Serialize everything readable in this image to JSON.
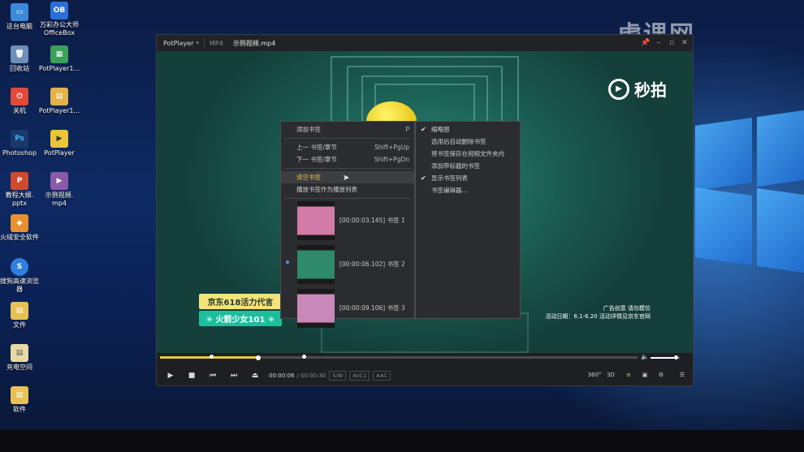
{
  "desktop": {
    "icons": [
      {
        "label": "这台电脑",
        "glyph": "▭",
        "color": "#3b8ad9"
      },
      {
        "label": "万彩办公大师\nOfficeBox",
        "glyph": "OB",
        "color": "#2a6fd8"
      },
      {
        "label": "回收站",
        "glyph": "🗑",
        "color": "#6f8fb8"
      },
      {
        "label": "PotPlayer1...",
        "glyph": "▦",
        "color": "#3aa05a"
      },
      {
        "label": "关机",
        "glyph": "⏻",
        "color": "#e04a3a"
      },
      {
        "label": "PotPlayer1...",
        "glyph": "▤",
        "color": "#e2b34a"
      },
      {
        "label": "Photoshop",
        "glyph": "Ps",
        "color": "#1b3a6a"
      },
      {
        "label": "PotPlayer",
        "glyph": "▶",
        "color": "#e9c53a"
      },
      {
        "label": "教程大纲.\npptx",
        "glyph": "P",
        "color": "#d04a2e"
      },
      {
        "label": "示例视频.\nmp4",
        "glyph": "▶",
        "color": "#8a5aa8"
      },
      {
        "label": "火绒安全软件",
        "glyph": "◆",
        "color": "#e8912e"
      },
      {
        "label": "搜狗高速浏览\n器",
        "glyph": "S",
        "color": "#2f7fe0"
      },
      {
        "label": "文件",
        "glyph": "▤",
        "color": "#e7c253"
      },
      {
        "label": "充电空间",
        "glyph": "▤",
        "color": "#e7d9a6"
      },
      {
        "label": "软件",
        "glyph": "▤",
        "color": "#e7c253"
      }
    ],
    "watermark": "虎课网"
  },
  "player": {
    "brand": "PotPlayer",
    "format": "MP4",
    "filename": "示例视频.mp4",
    "window_buttons": [
      "📌",
      "–",
      "▫",
      "✕"
    ],
    "video": {
      "logo_text": "秒拍",
      "badge_top": "京东618活力代言",
      "badge_bottom": "✳ 火箭少女101 ✳",
      "ad_line1": "广告创意 请勿模仿",
      "ad_line2": "活动日期：6.1-6.20 活动详情见京东官网"
    },
    "menu_left": {
      "add": {
        "label": "添加书签",
        "shortcut": "P"
      },
      "prev": {
        "label": "上一 书签/章节",
        "shortcut": "Shift+PgUp"
      },
      "next": {
        "label": "下一 书签/章节",
        "shortcut": "Shift+PgDn"
      },
      "clear": {
        "label": "清空书签"
      },
      "playlist": {
        "label": "播放书签作为播放列表"
      },
      "bookmarks": [
        {
          "label": "[00:00:03.145] 书签 1",
          "thumb": "#d27aa8"
        },
        {
          "label": "[00:00:06.102] 书签 2",
          "thumb": "#2e8a6a"
        },
        {
          "label": "[00:00:09.106] 书签 3",
          "thumb": "#c889b8"
        }
      ]
    },
    "menu_right": [
      {
        "label": "缩略图",
        "checked": "✔"
      },
      {
        "label": "选用后自动删除书签",
        "checked": ""
      },
      {
        "label": "将书签保存在视频文件夹内",
        "checked": ""
      },
      {
        "label": "添加带标题的书签",
        "checked": ""
      },
      {
        "label": "显示书签列表",
        "checked": "✔"
      },
      {
        "label": "书签编辑器...",
        "checked": ""
      }
    ],
    "controls": {
      "current_time": "00:00:06",
      "total_time": "/ 00:00:30",
      "tags": [
        "S/W",
        "AVC1",
        "AAC"
      ],
      "right_buttons": [
        "360°",
        "3D",
        "≡",
        "▣",
        "⚙",
        "☰"
      ],
      "progress_fraction": 0.205,
      "volume_fraction": 0.85
    }
  }
}
